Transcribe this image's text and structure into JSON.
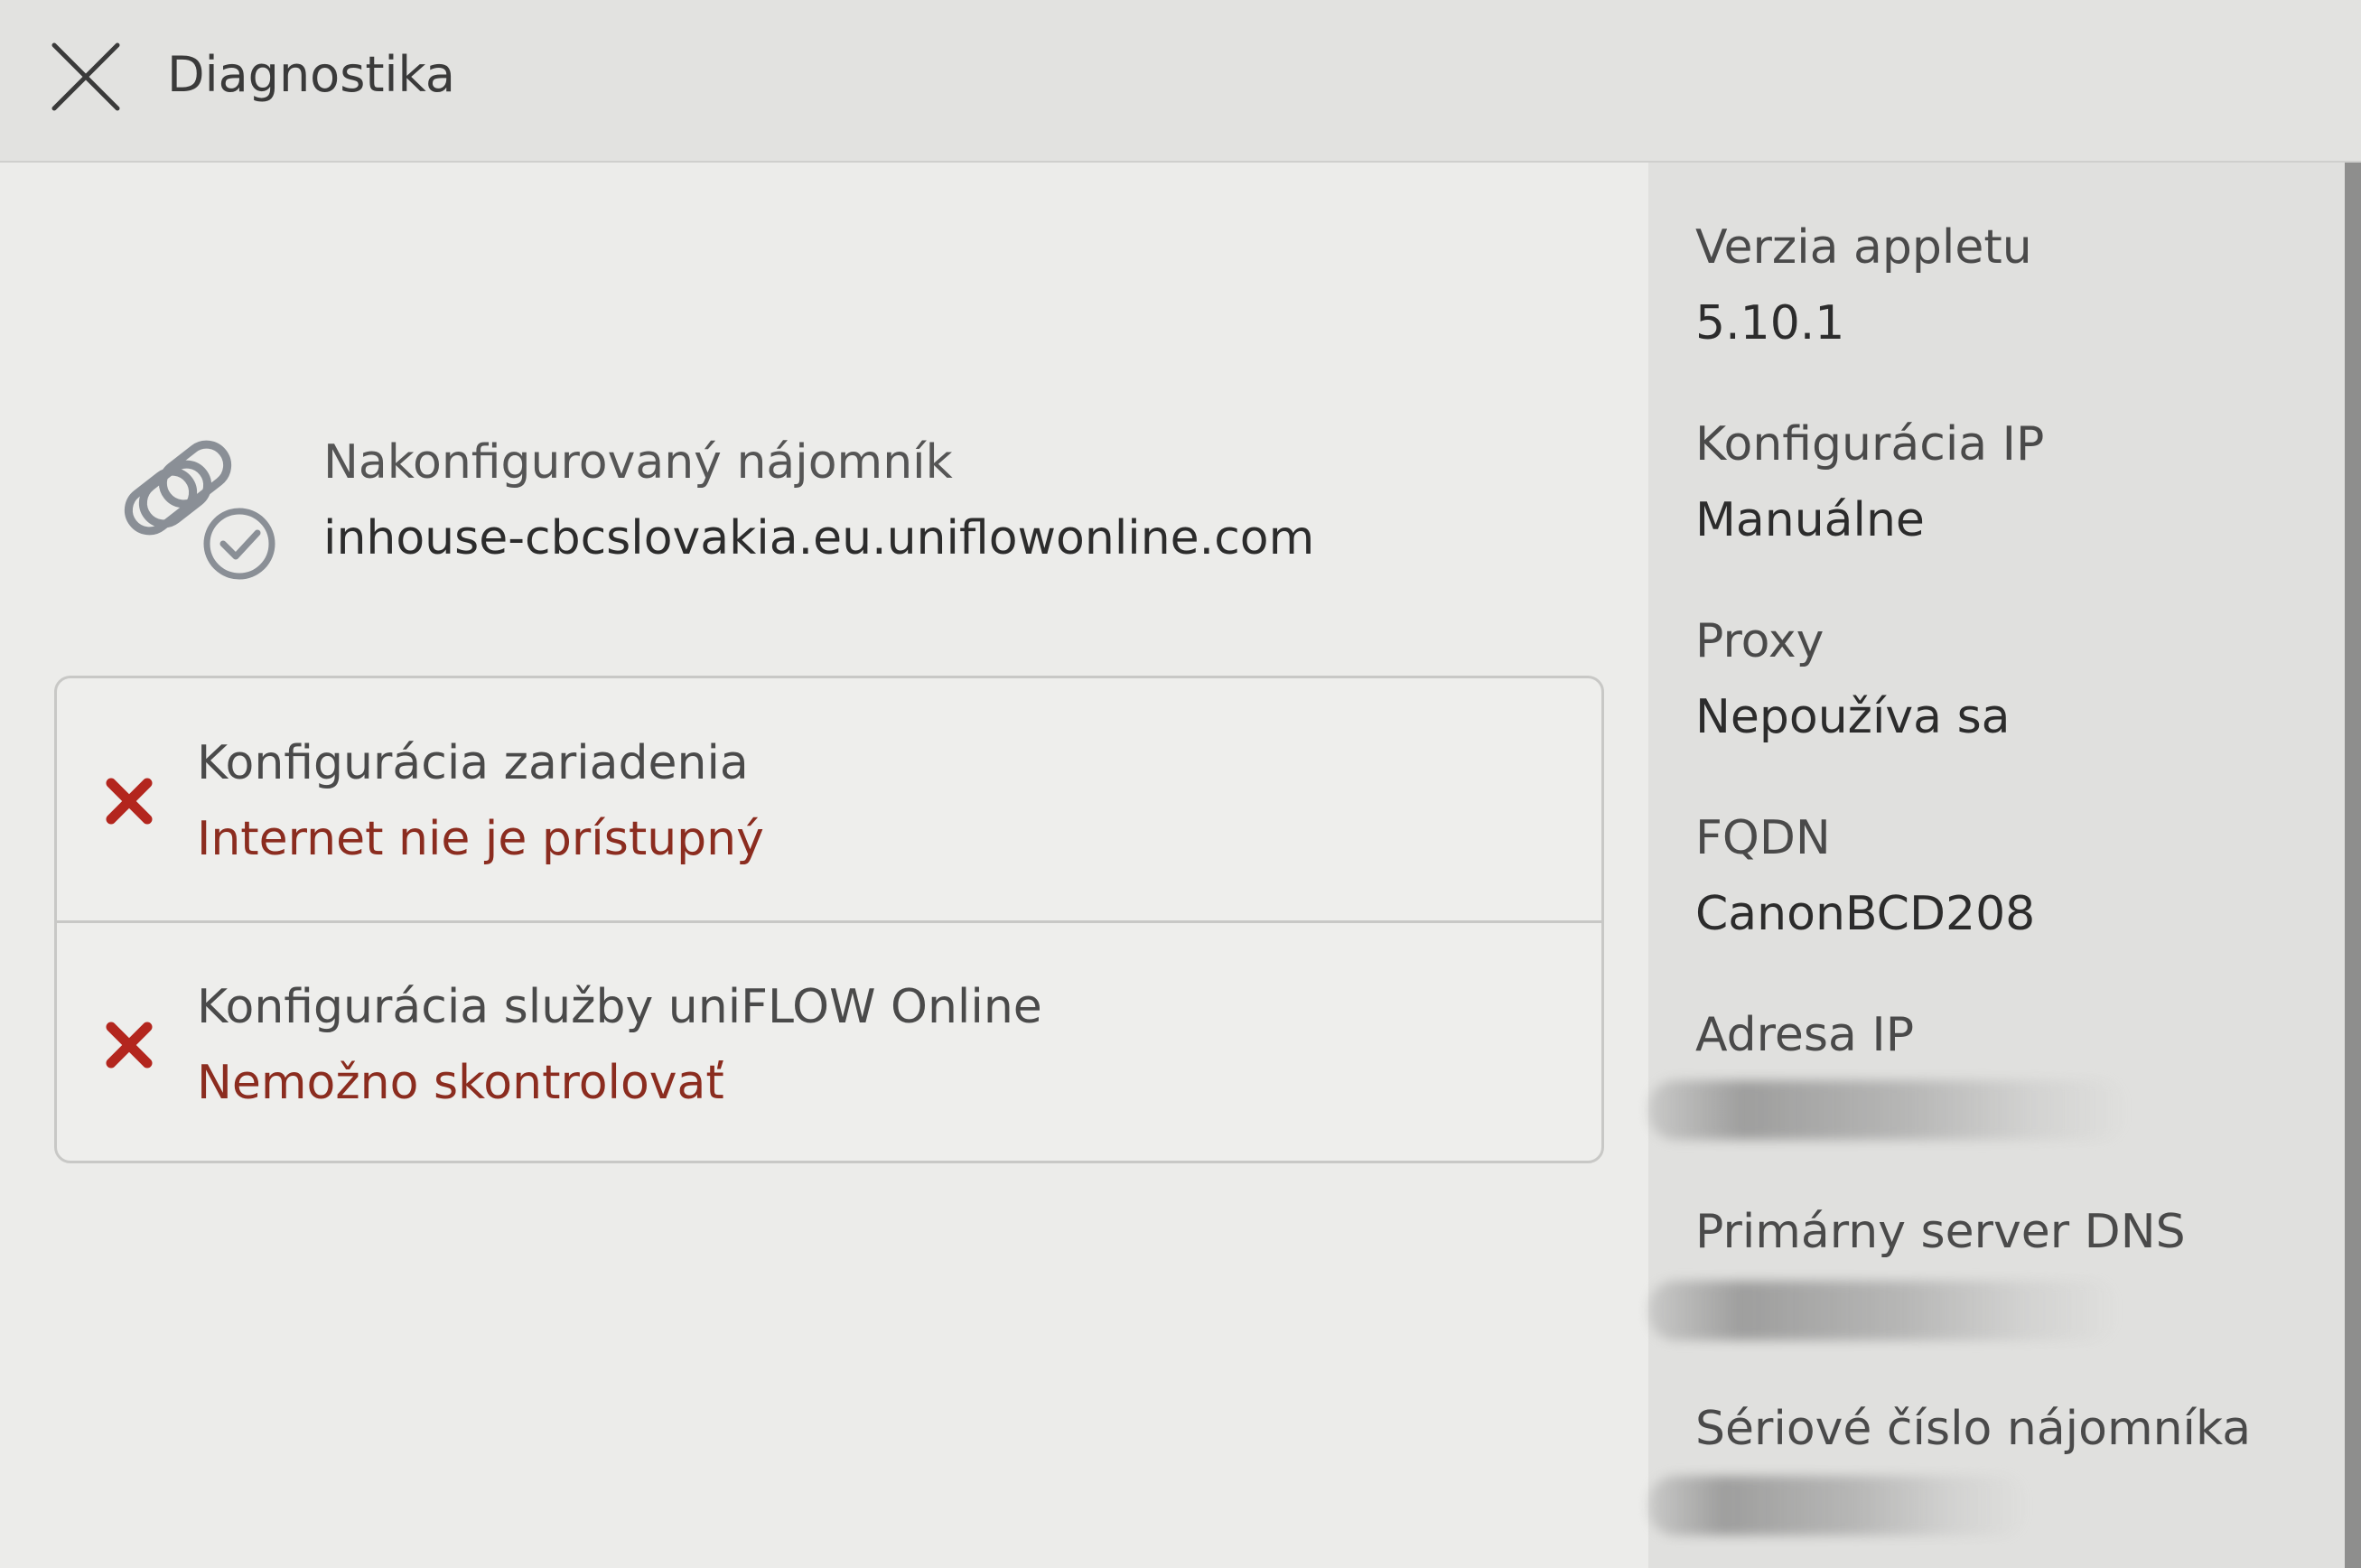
{
  "header": {
    "title": "Diagnostika",
    "close_icon": "close-icon"
  },
  "tenant": {
    "label": "Nakonfigurovaný nájomník",
    "value": "inhouse-cbcslovakia.eu.uniflowonline.com",
    "icon": "link-check-icon"
  },
  "checks": [
    {
      "title": "Konfigurácia zariadenia",
      "status": "Internet nie je prístupný",
      "icon": "error-x-icon"
    },
    {
      "title": "Konfigurácia služby uniFLOW Online",
      "status": "Nemožno skontrolovať",
      "icon": "error-x-icon"
    }
  ],
  "info": {
    "applet_version": {
      "label": "Verzia appletu",
      "value": "5.10.1"
    },
    "ip_config": {
      "label": "Konfigurácia IP",
      "value": "Manuálne"
    },
    "proxy": {
      "label": "Proxy",
      "value": "Nepoužíva sa"
    },
    "fqdn": {
      "label": "FQDN",
      "value": "CanonBCD208"
    },
    "ip_address": {
      "label": "Adresa IP"
    },
    "primary_dns": {
      "label": "Primárny server DNS"
    },
    "tenant_serial": {
      "label": "Sériové číslo nájomníka"
    }
  },
  "colors": {
    "error": "#b3261e",
    "error_text": "#8b2c1f",
    "text": "#2c2c2c"
  }
}
